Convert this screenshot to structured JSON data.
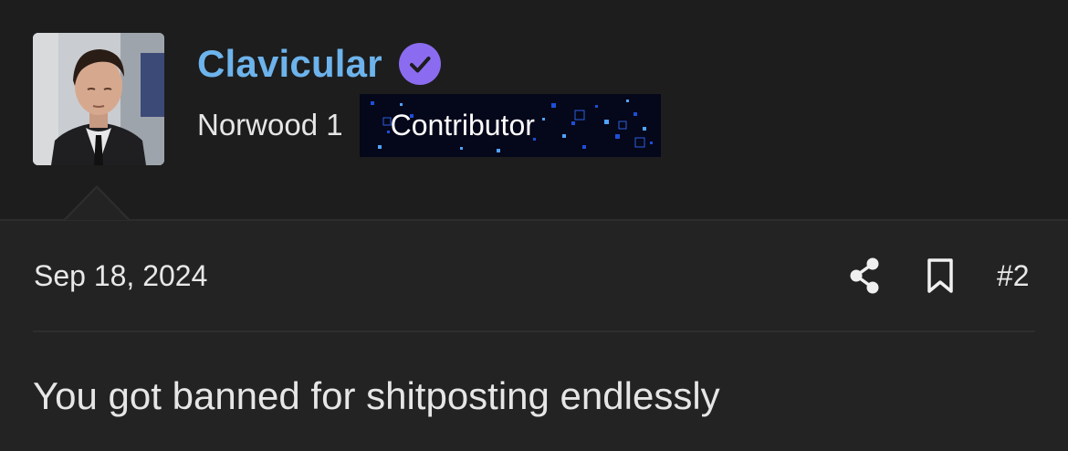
{
  "user": {
    "name": "Clavicular",
    "location": "Norwood 1",
    "banner_label": "Contributor"
  },
  "post": {
    "date": "Sep 18, 2024",
    "number": "#2",
    "message": "You got banned for shitposting endlessly"
  },
  "icons": {
    "verified": "verified-check-icon",
    "share": "share-icon",
    "bookmark": "bookmark-icon"
  },
  "colors": {
    "background": "#232323",
    "username": "#6db3ec",
    "verified_badge": "#8b6cf0",
    "text": "#e6e6e6"
  }
}
